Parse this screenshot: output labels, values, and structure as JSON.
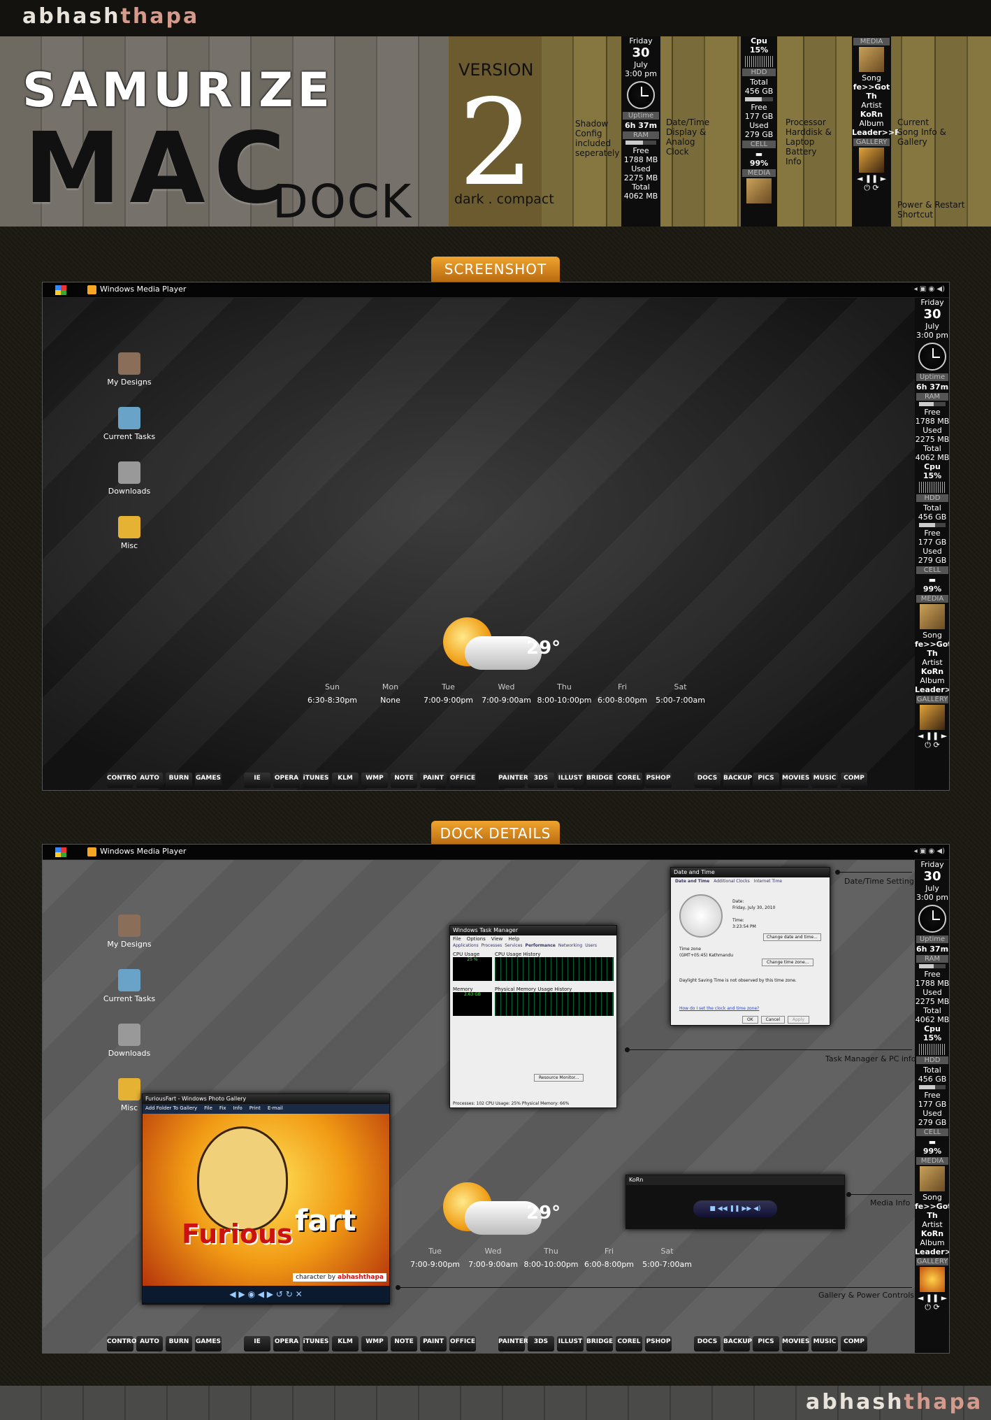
{
  "author": {
    "first": "abhash",
    "last": "thapa"
  },
  "banner": {
    "title_line1": "SAMURIZE",
    "title_line2": "MAC",
    "title_line3": "DOCK",
    "version_word": "VERSION",
    "version_number": "2",
    "version_sub": "dark . compact",
    "notes": {
      "shadow": "Shadow Config included seperately",
      "datetime": "Date/Time Display & Analog Clock",
      "processor": "Processor Harddisk & Laptop Battery Info",
      "song": "Current Song Info & Gallery",
      "power": "Power & Restart Shortcut"
    }
  },
  "widget": {
    "day": "Friday",
    "date": "30",
    "month": "July",
    "time": "3:00 pm",
    "uptime_label": "Uptime",
    "uptime": "6h 37m",
    "ram_label": "RAM",
    "ram_free_label": "Free",
    "ram_free": "1788 MB",
    "ram_used_label": "Used",
    "ram_used": "2275 MB",
    "ram_total_label": "Total",
    "ram_total": "4062 MB",
    "cpu": "Cpu 15%",
    "hdd_label": "HDD",
    "hdd_total_label": "Total",
    "hdd_total": "456 GB",
    "hdd_free_label": "Free",
    "hdd_free": "177 GB",
    "hdd_used_label": "Used",
    "hdd_used": "279 GB",
    "cell_label": "CELL",
    "cell_value": "99%",
    "media_label": "MEDIA",
    "song_label": "Song",
    "song": "fe>>Got Th",
    "artist_label": "Artist",
    "artist": "KoRn",
    "album_label": "Album",
    "album": "Leader>>F",
    "gallery_label": "GALLERY",
    "controls": "◄ ❚❚ ►"
  },
  "sections": {
    "screenshot": "SCREENSHOT",
    "dock_details": "DOCK DETAILS"
  },
  "taskbar": {
    "window_title": "Windows Media Player"
  },
  "desktop_icons": [
    "My Designs",
    "Current Tasks",
    "Downloads",
    "Misc"
  ],
  "weather": {
    "temp": "29°",
    "days1": [
      {
        "day": "Sun",
        "time": "6:30-8:30pm"
      },
      {
        "day": "Mon",
        "time": "None"
      },
      {
        "day": "Tue",
        "time": "7:00-9:00pm"
      },
      {
        "day": "Wed",
        "time": "7:00-9:00am"
      },
      {
        "day": "Thu",
        "time": "8:00-10:00pm"
      },
      {
        "day": "Fri",
        "time": "6:00-8:00pm"
      },
      {
        "day": "Sat",
        "time": "5:00-7:00am"
      }
    ],
    "days2": [
      {
        "day": "Tue",
        "time": "7:00-9:00pm"
      },
      {
        "day": "Wed",
        "time": "7:00-9:00am"
      },
      {
        "day": "Thu",
        "time": "8:00-10:00pm"
      },
      {
        "day": "Fri",
        "time": "6:00-8:00pm"
      },
      {
        "day": "Sat",
        "time": "5:00-7:00am"
      }
    ]
  },
  "dock": [
    "CONTROL",
    "AUTO",
    "BURN",
    "GAMES",
    "|",
    "IE",
    "OPERA",
    "iTUNES",
    "KLM",
    "WMP",
    "NOTE",
    "PAINT",
    "OFFICE",
    "|",
    "PAINTER",
    "3DS",
    "ILLUST",
    "BRIDGE",
    "COREL",
    "PSHOP",
    "|",
    "DOCS",
    "BACKUP",
    "PICS",
    "MOVIES",
    "MUSIC",
    "COMP"
  ],
  "callouts": {
    "datetime": "Date/Time Setting",
    "taskmgr": "Task Manager & PC info",
    "media": "Media Info",
    "gallery": "Gallery & Power Controls"
  },
  "windows": {
    "datetime_title": "Date and Time",
    "datetime_tabs": [
      "Date and Time",
      "Additional Clocks",
      "Internet Time"
    ],
    "date_label": "Date:",
    "date_value": "Friday, July 30, 2010",
    "time_label": "Time:",
    "time_value": "3:23:54 PM",
    "change_btn": "Change date and time...",
    "tz_label": "Time zone",
    "tz_value": "(GMT+05:45) Kathmandu",
    "tz_btn": "Change time zone...",
    "dst_note": "Daylight Saving Time is not observed by this time zone.",
    "help_link": "How do I set the clock and time zone?",
    "ok": "OK",
    "cancel": "Cancel",
    "apply": "Apply",
    "taskmgr_title": "Windows Task Manager",
    "taskmgr_menu": [
      "File",
      "Options",
      "View",
      "Help"
    ],
    "taskmgr_tabs": [
      "Applications",
      "Processes",
      "Services",
      "Performance",
      "Networking",
      "Users"
    ],
    "cpu_usage": "CPU Usage",
    "cpu_hist": "CPU Usage History",
    "cpu_pct": "25 %",
    "memory": "Memory",
    "mem_hist": "Physical Memory Usage History",
    "mem_val": "2.63 GB",
    "footer": "Processes: 102    CPU Usage: 25%    Physical Memory: 66%",
    "resource_btn": "Resource Monitor...",
    "wmp_title": "KoRn",
    "gallery_title": "FuriousFart - Windows Photo Gallery",
    "gallery_menu": [
      "Add Folder To Gallery",
      "File",
      "Fix",
      "Info",
      "Print",
      "E-mail"
    ],
    "art_text1": "Furious",
    "art_text2": "fart",
    "art_credit_pre": "character by",
    "art_credit": "abhashthapa"
  }
}
